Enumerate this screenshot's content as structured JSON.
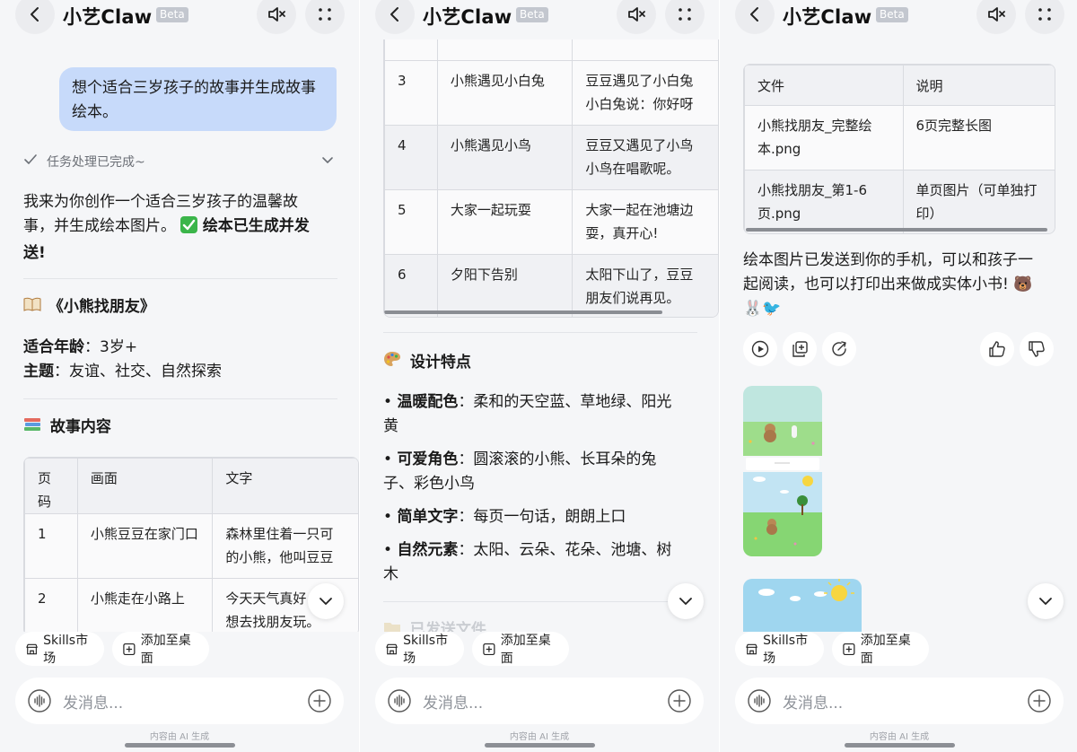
{
  "header": {
    "title": "小艺Claw",
    "badge": "Beta"
  },
  "icons": [
    "back-icon",
    "mute-icon",
    "more-icon",
    "check-icon",
    "chevron-down-icon",
    "mic-icon",
    "plus-icon",
    "store-icon",
    "add-square-icon",
    "play-icon",
    "copy-icon",
    "share-icon",
    "thumbs-up-icon",
    "thumbs-down-icon",
    "book-emoji",
    "books-emoji",
    "palette-emoji"
  ],
  "panel1": {
    "user_message": "想个适合三岁孩子的故事并生成故事绘本。",
    "status": "任务处理已完成~",
    "intro_line1": "我来为你创作一个适合三岁孩子的温馨故",
    "intro_line2": "事，并生成绘本图片。",
    "intro_done_a": "绘本已生成并发",
    "intro_done_b": "送!",
    "book_title": "《小熊找朋友》",
    "age_label": "适合年龄",
    "age_value": "：3岁+",
    "theme_label": "主题",
    "theme_value": "：友谊、社交、自然探索",
    "story_heading": "故事内容",
    "table": {
      "headers": [
        "页码",
        "画面",
        "文字"
      ],
      "rows": [
        {
          "page": "1",
          "scene": "小熊豆豆在家门口",
          "text1": "森林里住着一只可",
          "text2": "的小熊，他叫豆豆"
        },
        {
          "page": "2",
          "scene": "小熊走在小路上",
          "text1": "今天天气真好，豆",
          "text2": "想去找朋友玩。"
        }
      ]
    }
  },
  "panel2": {
    "table": {
      "rows": [
        {
          "page": "3",
          "scene": "小熊遇见小白兔",
          "text1": "豆豆遇见了小白兔",
          "text2": "小白兔说：你好呀"
        },
        {
          "page": "4",
          "scene": "小熊遇见小鸟",
          "text1": "豆豆又遇见了小鸟",
          "text2": "小鸟在唱歌呢。"
        },
        {
          "page": "5",
          "scene": "大家一起玩耍",
          "text1": "大家一起在池塘边",
          "text2": "耍，真开心!"
        },
        {
          "page": "6",
          "scene": "夕阳下告别",
          "text1": "太阳下山了，豆豆",
          "text2": "朋友们说再见。"
        }
      ]
    },
    "design_heading": "设计特点",
    "features": [
      {
        "label": "温暖配色",
        "text_a": "：柔和的天空蓝、草地绿、阳光",
        "text_b": "黄"
      },
      {
        "label": "可爱角色",
        "text_a": "：圆滚滚的小熊、长耳朵的兔",
        "text_b": "子、彩色小鸟"
      },
      {
        "label": "简单文字",
        "text_a": "：每页一句话，朗朗上口",
        "text_b": ""
      },
      {
        "label": "自然元素",
        "text_a": "：太阳、云朵、花朵、池塘、树",
        "text_b": "木"
      }
    ],
    "faded_heading": "已发送文件"
  },
  "panel3": {
    "table": {
      "headers": [
        "文件",
        "说明"
      ],
      "rows": [
        {
          "file1": "小熊找朋友_完整绘",
          "file2": "本.png",
          "desc1": "6页完整长图",
          "desc2": ""
        },
        {
          "file1": "小熊找朋友_第1-6",
          "file2": "页.png",
          "desc1": "单页图片（可单独打",
          "desc2": "印）"
        }
      ]
    },
    "sent_line1": "绘本图片已发送到你的手机，可以和孩子一",
    "sent_line2": "起阅读，也可以打印出来做成实体小书! 🐻",
    "sent_line3": "🐰🐦"
  },
  "bottom": {
    "chip_skills": "Skills市场",
    "chip_desk": "添加至桌面",
    "input_placeholder": "发消息...",
    "ai_note": "内容由 AI 生成"
  },
  "colors": {
    "user_bubble": "#c7dafa",
    "panel_bg": "#f5f6f8",
    "check_emoji": "#3bb54a"
  }
}
